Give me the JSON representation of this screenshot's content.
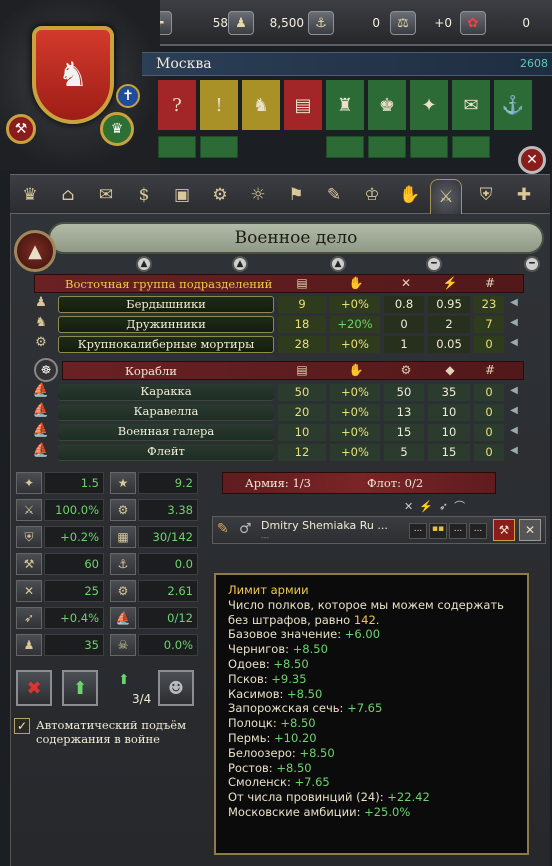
{
  "topbar": {
    "resources": [
      {
        "icon": "treasury-icon",
        "value": "58"
      },
      {
        "icon": "manpower-icon",
        "value": "8,500"
      },
      {
        "icon": "sailors-icon",
        "value": "0"
      },
      {
        "icon": "stability-icon",
        "value": "+0"
      },
      {
        "icon": "prestige-icon",
        "value": "0"
      }
    ]
  },
  "country": {
    "name": "Москва",
    "power": "2608"
  },
  "panel_title": "Военное дело",
  "land": {
    "group_label": "Восточная группа подразделений",
    "units": [
      {
        "name": "Бердышники",
        "cost": "9",
        "mod": "+0%",
        "v1": "0.8",
        "v2": "0.95",
        "count": "23"
      },
      {
        "name": "Дружинники",
        "cost": "18",
        "mod": "+20%",
        "v1": "0",
        "v2": "2",
        "count": "7"
      },
      {
        "name": "Крупнокалиберные мортиры",
        "cost": "28",
        "mod": "+0%",
        "v1": "1",
        "v2": "0.05",
        "count": "0"
      }
    ]
  },
  "naval": {
    "group_label": "Корабли",
    "units": [
      {
        "name": "Каракка",
        "cost": "50",
        "mod": "+0%",
        "v1": "50",
        "v2": "35",
        "count": "0"
      },
      {
        "name": "Каравелла",
        "cost": "20",
        "mod": "+0%",
        "v1": "13",
        "v2": "10",
        "count": "0"
      },
      {
        "name": "Военная галера",
        "cost": "10",
        "mod": "+0%",
        "v1": "15",
        "v2": "10",
        "count": "0"
      },
      {
        "name": "Флейт",
        "cost": "12",
        "mod": "+0%",
        "v1": "5",
        "v2": "15",
        "count": "0"
      }
    ]
  },
  "stats_left": [
    "1.5",
    "100.0%",
    "+0.2%",
    "60",
    "25",
    "+0.4%",
    "35"
  ],
  "stats_right": [
    "9.2",
    "3.38",
    "30/142",
    "0.0",
    "2.61",
    "0/12",
    "0.0%"
  ],
  "limit_label": "3/4",
  "auto_raise_label": "Автоматический подъём содержания в войне",
  "army_bar": {
    "army": "Армия: 1/3",
    "fleet": "Флот: 0/2"
  },
  "leader": {
    "name": "Dmitry Shemiaka Ru ...",
    "sub": "---",
    "stats": [
      "...",
      "...",
      "..."
    ]
  },
  "tooltip": {
    "title": "Лимит армии",
    "line1": "Число полков, которое мы можем содержать без штрафов, равно ",
    "line1_value": "142",
    "line1_end": ".",
    "rows": [
      {
        "label": "Базовое значение: ",
        "value": "+6.00"
      },
      {
        "label": "Чернигов: ",
        "value": "+8.50"
      },
      {
        "label": "Одоев: ",
        "value": "+8.50"
      },
      {
        "label": "Псков: ",
        "value": "+9.35"
      },
      {
        "label": "Касимов: ",
        "value": "+8.50"
      },
      {
        "label": "Запорожская сечь: ",
        "value": "+7.65"
      },
      {
        "label": "Полоцк: ",
        "value": "+8.50"
      },
      {
        "label": "Пермь: ",
        "value": "+10.20"
      },
      {
        "label": "Белоозеро: ",
        "value": "+8.50"
      },
      {
        "label": "Ростов: ",
        "value": "+8.50"
      },
      {
        "label": "Смоленск: ",
        "value": "+7.65"
      },
      {
        "label": "От числа провинций (24): ",
        "value": "+22.42"
      },
      {
        "label": "Московские амбиции: ",
        "value": "+25.0%"
      }
    ]
  },
  "colors": {
    "accent_gold": "#f1c94b",
    "positive": "#6dd46d",
    "dark_red": "#6a2123"
  }
}
